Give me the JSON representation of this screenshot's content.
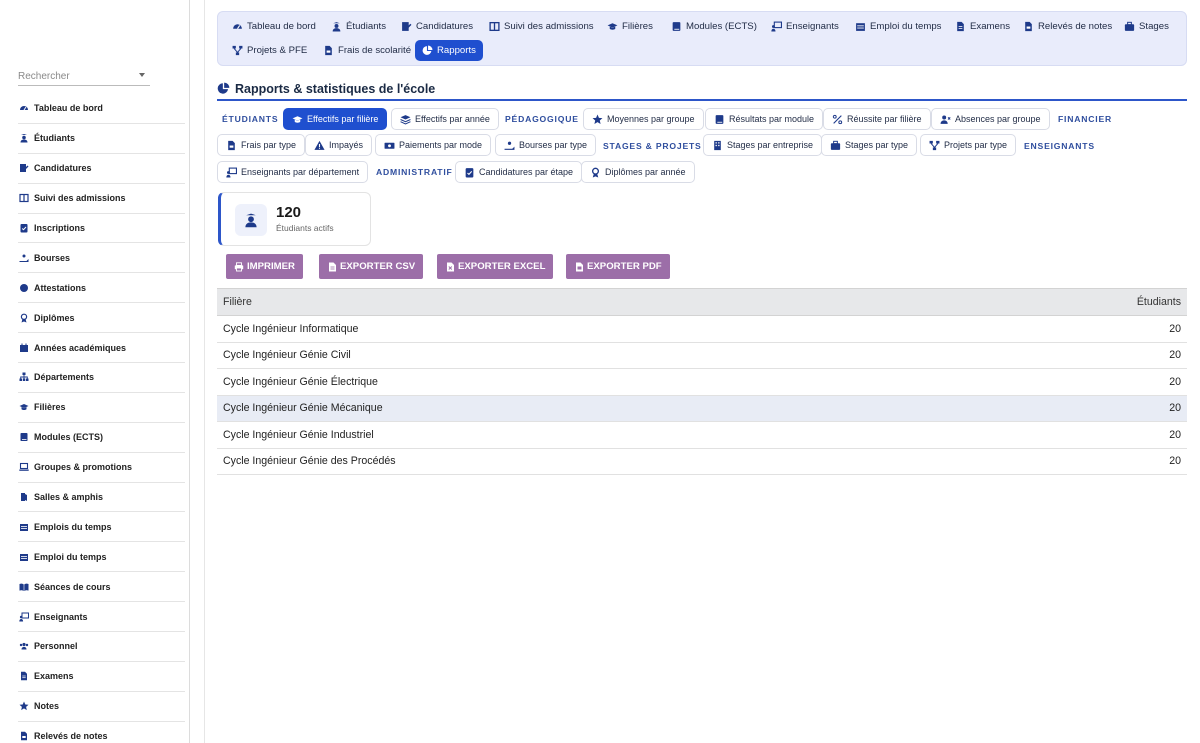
{
  "sidebar": {
    "search_placeholder": "Rechercher",
    "items": [
      {
        "label": "Tableau de bord",
        "icon": "gauge-icon"
      },
      {
        "label": "Étudiants",
        "icon": "student-icon"
      },
      {
        "label": "Candidatures",
        "icon": "file-signature-icon"
      },
      {
        "label": "Suivi des admissions",
        "icon": "columns-icon"
      },
      {
        "label": "Inscriptions",
        "icon": "clipboard-check-icon"
      },
      {
        "label": "Bourses",
        "icon": "hand-holding-icon"
      },
      {
        "label": "Attestations",
        "icon": "certificate-icon"
      },
      {
        "label": "Diplômes",
        "icon": "award-icon"
      },
      {
        "label": "Années académiques",
        "icon": "calendar-icon"
      },
      {
        "label": "Départements",
        "icon": "sitemap-icon"
      },
      {
        "label": "Filières",
        "icon": "graduation-cap-icon"
      },
      {
        "label": "Modules (ECTS)",
        "icon": "book-icon"
      },
      {
        "label": "Groupes & promotions",
        "icon": "laptop-icon"
      },
      {
        "label": "Salles & amphis",
        "icon": "door-icon"
      },
      {
        "label": "Emplois du temps",
        "icon": "calendar-days-icon"
      },
      {
        "label": "Emploi du temps",
        "icon": "calendar-days-icon"
      },
      {
        "label": "Séances de cours",
        "icon": "book-open-icon"
      },
      {
        "label": "Enseignants",
        "icon": "chalkboard-teacher-icon"
      },
      {
        "label": "Personnel",
        "icon": "users-icon"
      },
      {
        "label": "Examens",
        "icon": "file-lines-icon"
      },
      {
        "label": "Notes",
        "icon": "star-icon"
      },
      {
        "label": "Relevés de notes",
        "icon": "file-invoice-icon"
      }
    ]
  },
  "topnav": {
    "items": [
      {
        "label": "Tableau de bord",
        "icon": "gauge-icon",
        "active": false
      },
      {
        "label": "Étudiants",
        "icon": "student-icon",
        "active": false
      },
      {
        "label": "Candidatures",
        "icon": "file-signature-icon",
        "active": false
      },
      {
        "label": "Suivi des admissions",
        "icon": "columns-icon",
        "active": false
      },
      {
        "label": "Filières",
        "icon": "graduation-cap-icon",
        "active": false
      },
      {
        "label": "Modules (ECTS)",
        "icon": "book-icon",
        "active": false
      },
      {
        "label": "Enseignants",
        "icon": "chalkboard-teacher-icon",
        "active": false
      },
      {
        "label": "Emploi du temps",
        "icon": "calendar-days-icon",
        "active": false
      },
      {
        "label": "Examens",
        "icon": "file-lines-icon",
        "active": false
      },
      {
        "label": "Relevés de notes",
        "icon": "file-invoice-icon",
        "active": false
      },
      {
        "label": "Stages",
        "icon": "briefcase-icon",
        "active": false
      },
      {
        "label": "Projets & PFE",
        "icon": "diagram-project-icon",
        "active": false
      },
      {
        "label": "Frais de scolarité",
        "icon": "file-invoice-icon",
        "active": false
      },
      {
        "label": "Rapports",
        "icon": "chart-pie-icon",
        "active": true
      }
    ]
  },
  "page": {
    "title": "Rapports & statistiques de l'école"
  },
  "categories": {
    "etudiants": "ÉTUDIANTS",
    "pedagogique": "PÉDAGOGIQUE",
    "financier": "FINANCIER",
    "stages": "STAGES & PROJETS",
    "enseignants": "ENSEIGNANTS",
    "administratif": "ADMINISTRATIF"
  },
  "reports": {
    "effectifs_filiere": "Effectifs par filière",
    "effectifs_annee": "Effectifs par année",
    "moyennes_groupe": "Moyennes par groupe",
    "resultats_module": "Résultats par module",
    "reussite_filiere": "Réussite par filière",
    "absences_groupe": "Absences par groupe",
    "frais_type": "Frais par type",
    "impayes": "Impayés",
    "paiements_mode": "Paiements par mode",
    "bourses_type": "Bourses par type",
    "stages_entreprise": "Stages par entreprise",
    "stages_type": "Stages par type",
    "projets_type": "Projets par type",
    "enseignants_departement": "Enseignants par département",
    "candidatures_etape": "Candidatures par étape",
    "diplomes_annee": "Diplômes par année"
  },
  "stat": {
    "value": "120",
    "label": "Étudiants actifs"
  },
  "exports": {
    "print": "IMPRIMER",
    "csv": "EXPORTER CSV",
    "excel": "EXPORTER EXCEL",
    "pdf": "EXPORTER PDF"
  },
  "table": {
    "col_filiere": "Filière",
    "col_etudiants": "Étudiants",
    "rows": [
      {
        "filiere": "Cycle Ingénieur Informatique",
        "etudiants": "20"
      },
      {
        "filiere": "Cycle Ingénieur Génie Civil",
        "etudiants": "20"
      },
      {
        "filiere": "Cycle Ingénieur Génie Électrique",
        "etudiants": "20"
      },
      {
        "filiere": "Cycle Ingénieur Génie Mécanique",
        "etudiants": "20"
      },
      {
        "filiere": "Cycle Ingénieur Génie Industriel",
        "etudiants": "20"
      },
      {
        "filiere": "Cycle Ingénieur Génie des Procédés",
        "etudiants": "20"
      }
    ]
  },
  "colors": {
    "accent": "#1f4fcf",
    "export_button": "#9c6ea8",
    "topnav_bg": "#e9ecfb",
    "category_label": "#2f4e9e"
  }
}
